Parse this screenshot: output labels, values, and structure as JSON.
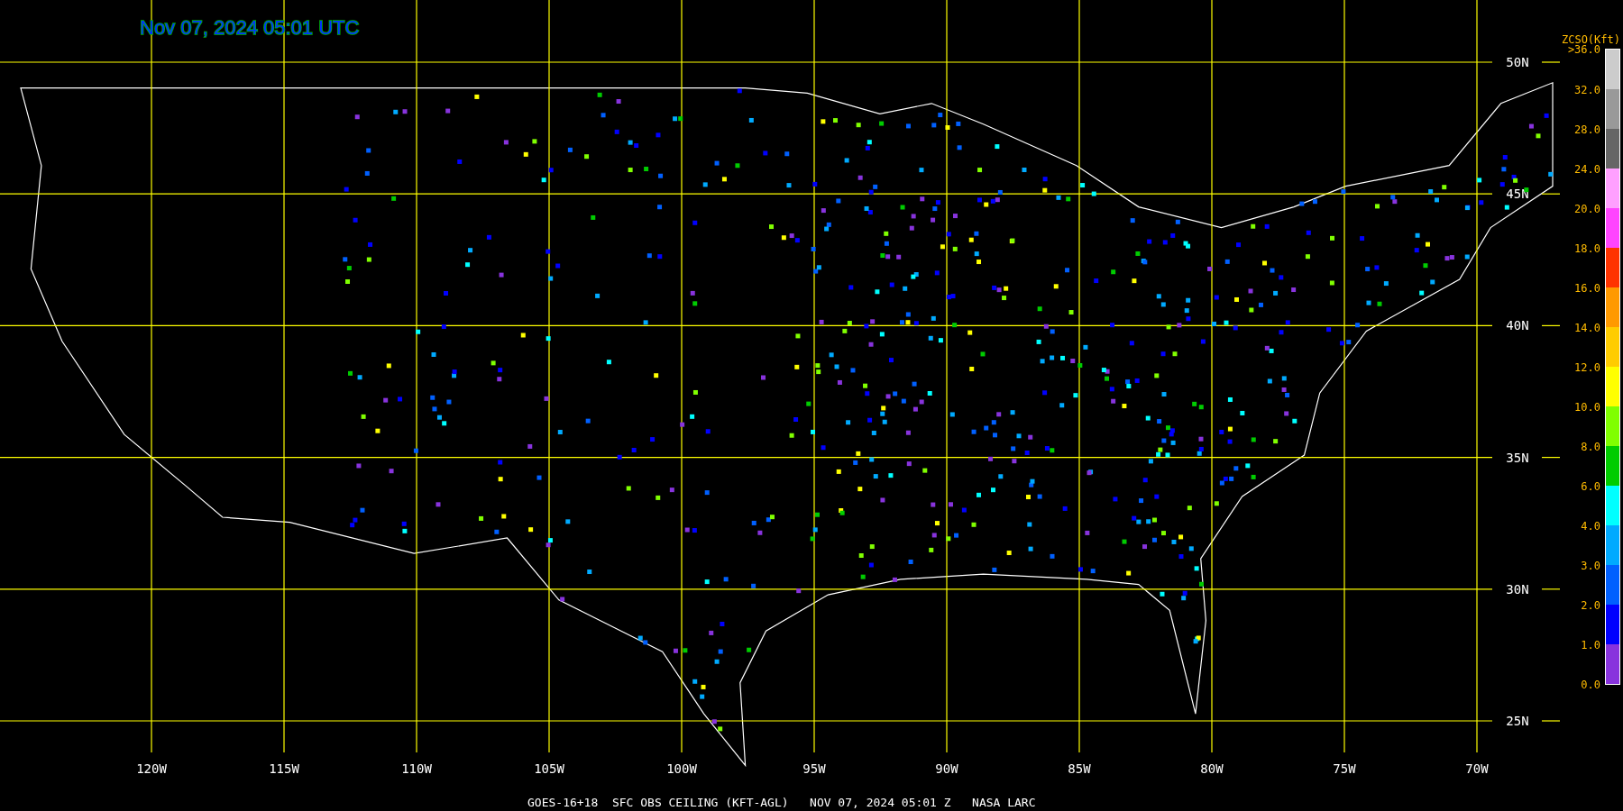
{
  "title": "Nov 07, 2024 05:01 UTC",
  "grid": {
    "lat_labels": [
      "50N",
      "45N",
      "40N",
      "35N",
      "30N",
      "25N"
    ],
    "lon_labels": [
      "120W",
      "115W",
      "110W",
      "105W",
      "100W",
      "95W",
      "90W",
      "85W",
      "80W",
      "75W",
      "70W"
    ]
  },
  "legend": {
    "title": "ZCSO(Kft)",
    "labels": [
      ">36.0",
      "32.0",
      "28.0",
      "24.0",
      "20.0",
      "18.0",
      "16.0",
      "14.0",
      "12.0",
      "10.0",
      "8.0",
      "6.0",
      "4.0",
      "3.0",
      "2.0",
      "1.0",
      "0.0"
    ],
    "segments": [
      {
        "color": "#cccccc"
      },
      {
        "color": "#999999"
      },
      {
        "color": "#666666"
      },
      {
        "color": "#ffa0ff"
      },
      {
        "color": "#ff44ff"
      },
      {
        "color": "#ff3300"
      },
      {
        "color": "#ff9900"
      },
      {
        "color": "#ffcc00"
      },
      {
        "color": "#ffff00"
      },
      {
        "color": "#80ff00"
      },
      {
        "color": "#00cc00"
      },
      {
        "color": "#00ffff"
      },
      {
        "color": "#00aaff"
      },
      {
        "color": "#0060ff"
      },
      {
        "color": "#0000ff"
      },
      {
        "color": "#8833dd"
      }
    ]
  },
  "caption": "GOES-16+18  SFC OBS CEILING (KFT-AGL)   NOV 07, 2024 05:01 Z   NASA LARC"
}
